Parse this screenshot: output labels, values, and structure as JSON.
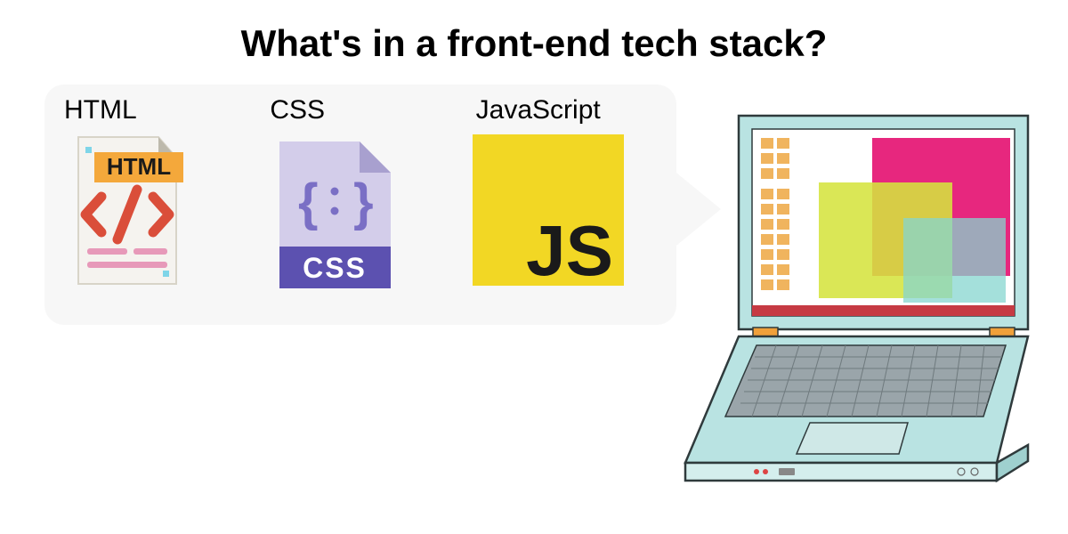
{
  "title": "What's in a front-end tech stack?",
  "techs": {
    "html": {
      "label": "HTML",
      "badge": "HTML"
    },
    "css": {
      "label": "CSS",
      "badge": "CSS"
    },
    "js": {
      "label": "JavaScript",
      "badge": "JS"
    }
  }
}
